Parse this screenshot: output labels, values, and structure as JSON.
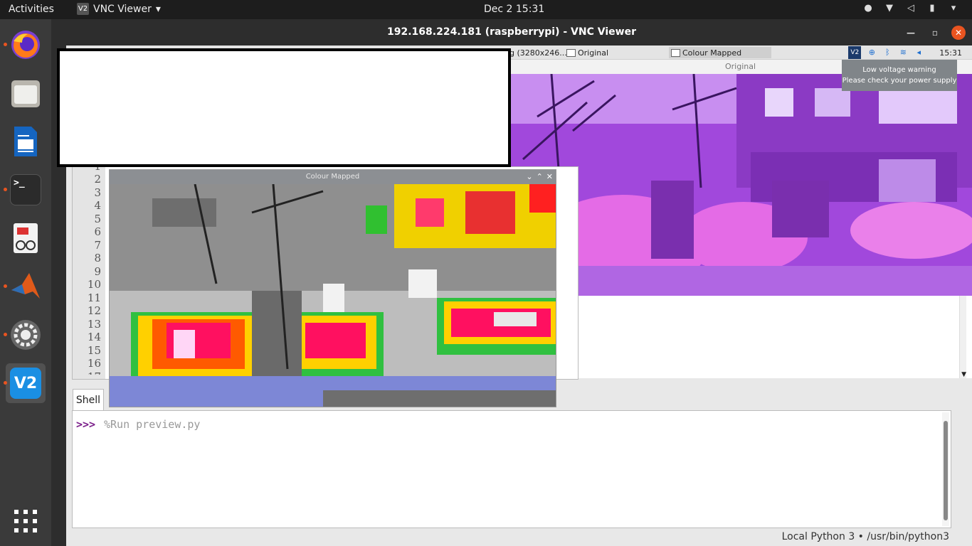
{
  "topbar": {
    "activities": "Activities",
    "app_name": "VNC Viewer",
    "app_icon_text": "V2",
    "clock": "Dec 2  15:31"
  },
  "dock": {
    "items": [
      "firefox",
      "files",
      "writer",
      "terminal",
      "document-viewer",
      "matlab",
      "settings",
      "vnc-viewer"
    ],
    "terminal_glyph": ">_",
    "vnc_glyph": "V2",
    "show_apps_glyph": "⋮⋮⋮"
  },
  "vnc": {
    "title": "192.168.224.181 (raspberrypi) - VNC Viewer"
  },
  "pi_taskbar": {
    "tasks": [
      "g (3280x246...",
      "Original",
      "Colour Mapped"
    ],
    "time": "15:31",
    "vnc_tray_text": "V2"
  },
  "original_window": {
    "title": "Original"
  },
  "low_voltage": {
    "line1": "Low voltage warning",
    "line2": "Please check your power supply"
  },
  "editor": {
    "line_numbers": [
      "1",
      "2",
      "3",
      "4",
      "5",
      "6",
      "7",
      "8",
      "9",
      "10",
      "11",
      "12",
      "13",
      "14",
      "15",
      "16",
      "17"
    ]
  },
  "colour_mapped_window": {
    "title": "Colour Mapped"
  },
  "shell": {
    "tab_label": "Shell",
    "prompt": ">>>",
    "command": "%Run preview.py"
  },
  "status": {
    "interpreter": "Local Python 3  •  /usr/bin/python3"
  },
  "colors": {
    "ubuntu_orange": "#e95420",
    "prompt_purple": "#7b1f8a"
  }
}
